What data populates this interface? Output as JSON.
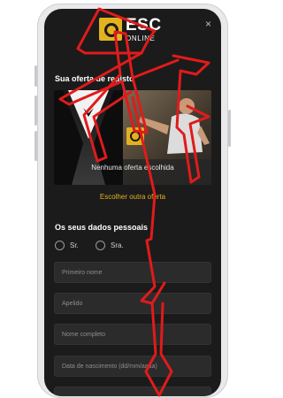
{
  "logo": {
    "main": "ESC",
    "sub": "ONLINE"
  },
  "close_icon": "×",
  "offer": {
    "title": "Sua oferta de registo",
    "banner_text": "Nenhuma oferta escolhida",
    "other_link": "Escolher outra oferta"
  },
  "personal": {
    "title": "Os seus dados pessoais",
    "options": [
      "Sr.",
      "Sra."
    ]
  },
  "fields": [
    "Primeiro nome",
    "Apelido",
    "Nome completo",
    "Data de nascimento (dd/mm/aaaa)"
  ],
  "colors": {
    "accent": "#e3b21f",
    "background": "#1b1b1b",
    "field_bg": "#2b2b2b",
    "arrow": "#e01b1b"
  }
}
